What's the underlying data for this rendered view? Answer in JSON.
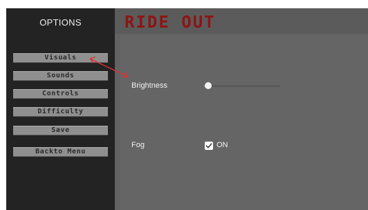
{
  "sidebar": {
    "title": "OPTIONS",
    "items": [
      {
        "label": "Visuals"
      },
      {
        "label": "Sounds"
      },
      {
        "label": "Controls"
      },
      {
        "label": "Difficulty"
      },
      {
        "label": "Save"
      },
      {
        "label": "Backto Menu"
      }
    ]
  },
  "header": {
    "title": "RIDE OUT"
  },
  "visuals": {
    "brightness_label": "Brightness",
    "brightness_value": 0.04,
    "fog_label": "Fog",
    "fog_checked": true,
    "fog_state": "ON"
  },
  "colors": {
    "title_red": "#8e1414",
    "annotation_arrow": "#e03030"
  },
  "icons": {
    "checkbox": "check-icon",
    "annotation": "arrow-icon"
  }
}
